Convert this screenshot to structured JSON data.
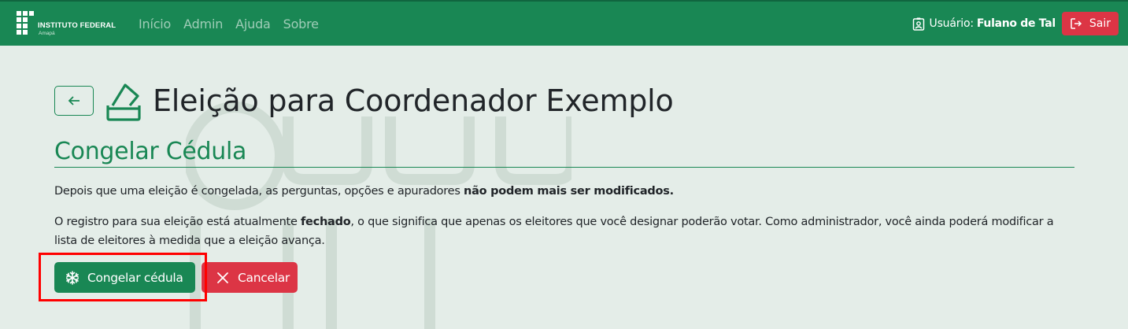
{
  "navbar": {
    "brand_name": "INSTITUTO FEDERAL",
    "brand_campus": "Amapá",
    "links": [
      {
        "label": "Início"
      },
      {
        "label": "Admin"
      },
      {
        "label": "Ajuda"
      },
      {
        "label": "Sobre"
      }
    ],
    "user_label": "Usuário:",
    "user_name": "Fulano de Tal",
    "logout_label": "Sair"
  },
  "page": {
    "title": "Eleição para Coordenador Exemplo",
    "section_title": "Congelar Cédula",
    "para1_text": "Depois que uma eleição é congelada, as perguntas, opções e apuradores ",
    "para1_bold": "não podem mais ser modificados.",
    "para2_before": "O registro para sua eleição está atualmente ",
    "para2_bold": "fechado",
    "para2_after": ", o que significa que apenas os eleitores que você designar poderão votar. Como administrador, você ainda poderá modificar a lista de eleitores à medida que a eleição avança."
  },
  "actions": {
    "freeze_label": "Congelar cédula",
    "cancel_label": "Cancelar"
  },
  "colors": {
    "primary": "#198754",
    "danger": "#dc3545",
    "background": "#e4ede8",
    "highlight": "#ff0000"
  },
  "icons": [
    "brand-logo-icon",
    "user-badge-icon",
    "logout-icon",
    "arrow-left-icon",
    "ballot-box-icon",
    "snowflake-icon",
    "x-icon"
  ]
}
